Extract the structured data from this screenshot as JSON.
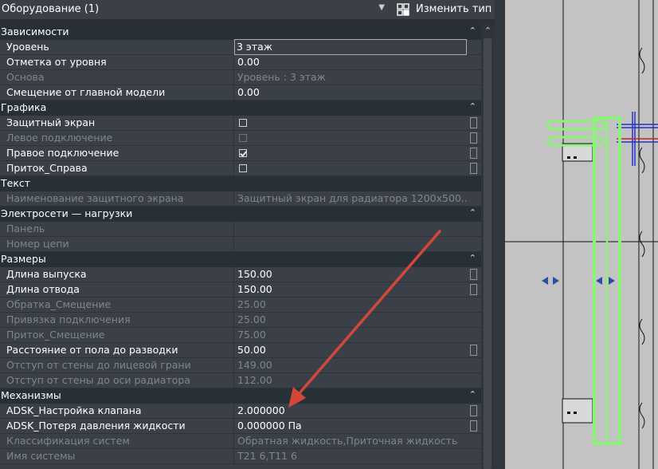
{
  "top": {
    "type_selector": "Оборудование (1)",
    "edit_type": "Изменить тип"
  },
  "groups": [
    {
      "label": "Зависимости",
      "rows": [
        {
          "name": "Уровень",
          "value": "3 этаж",
          "editing": true
        },
        {
          "name": "Отметка от уровня",
          "value": "0.00"
        },
        {
          "name": "Основа",
          "value": "Уровень : 3 этаж",
          "disabled": true
        },
        {
          "name": "Смещение от главной модели",
          "value": "0.00"
        }
      ]
    },
    {
      "label": "Графика",
      "rows": [
        {
          "name": "Защитный экран",
          "checkbox": true,
          "checked": false,
          "assoc": true
        },
        {
          "name": "Левое подключение",
          "checkbox": true,
          "checked": false,
          "disabled": true,
          "assoc": true
        },
        {
          "name": "Правое подключение",
          "checkbox": true,
          "checked": true,
          "assoc": true
        },
        {
          "name": "Приток_Справа",
          "checkbox": true,
          "checked": false,
          "assoc": true
        }
      ]
    },
    {
      "label": "Текст",
      "rows": [
        {
          "name": "Наименование защитного экрана",
          "value": "Защитный экран для радиатора 1200x500...",
          "disabled": true
        }
      ]
    },
    {
      "label": "Электросети — нагрузки",
      "rows": [
        {
          "name": "Панель",
          "value": "",
          "disabled": true
        },
        {
          "name": "Номер цепи",
          "value": "",
          "disabled": true
        }
      ]
    },
    {
      "label": "Размеры",
      "rows": [
        {
          "name": "Длина выпуска",
          "value": "150.00",
          "assoc": true
        },
        {
          "name": "Длина отвода",
          "value": "150.00",
          "assoc": true
        },
        {
          "name": "Обратка_Смещение",
          "value": "25.00",
          "disabled": true
        },
        {
          "name": "Привязка подключения",
          "value": "25.00",
          "disabled": true
        },
        {
          "name": "Приток_Смещение",
          "value": "75.00",
          "disabled": true
        },
        {
          "name": "Расстояние от пола до разводки",
          "value": "50.00",
          "assoc": true
        },
        {
          "name": "Отступ от стены до лицевой грани",
          "value": "149.00",
          "disabled": true
        },
        {
          "name": "Отступ от стены до оси радиатора",
          "value": "112.00",
          "disabled": true
        }
      ]
    },
    {
      "label": "Механизмы",
      "rows": [
        {
          "name": "ADSK_Настройка клапана",
          "value": "2.000000",
          "assoc": true
        },
        {
          "name": "ADSK_Потеря давления жидкости",
          "value": "0.000000 Па",
          "assoc": true
        },
        {
          "name": "Классификация систем",
          "value": "Обратная жидкость,Приточная жидкость",
          "disabled": true
        },
        {
          "name": "Имя системы",
          "value": "T21 6,T11 6",
          "disabled": true
        }
      ]
    }
  ],
  "icons": {
    "collapse": "double-chevron-up-icon",
    "dropdown": "chevron-down-icon",
    "edit_type": "edit-type-icon"
  },
  "colors": {
    "panel": "#3b4048",
    "group_header": "#283037",
    "disabled_text": "#7e858e",
    "annotation_arrow": "#d2473b",
    "selected_element": "#8df27a"
  }
}
